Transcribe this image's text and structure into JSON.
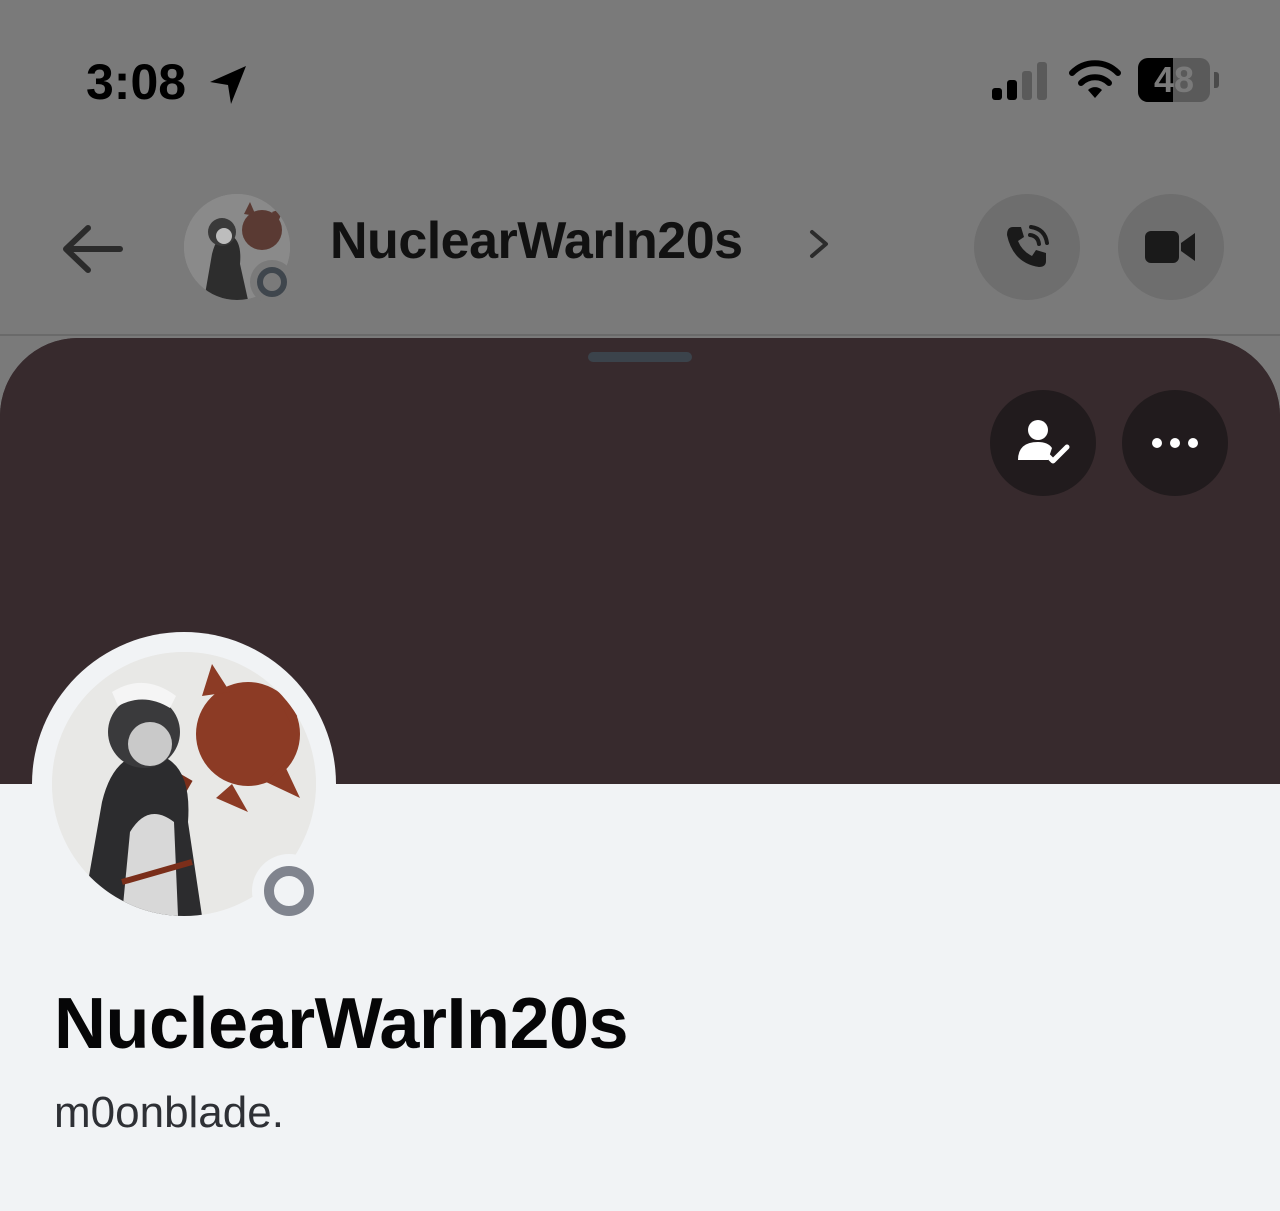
{
  "status_bar": {
    "time": "3:08",
    "battery_level": "48",
    "battery_fraction": 0.48,
    "icons": [
      "location-arrow-icon",
      "cellular-signal-icon",
      "wifi-icon",
      "battery-icon"
    ]
  },
  "header": {
    "title": "NuclearWarIn20s",
    "back_icon": "arrow-left-icon",
    "chevron_icon": "chevron-right-icon",
    "status": "offline",
    "actions": [
      "phone-call-icon",
      "video-camera-icon"
    ]
  },
  "profile": {
    "display_name": "NuclearWarIn20s",
    "username": "m0onblade.",
    "status": "offline",
    "actions": [
      "friend-check-icon",
      "more-options-icon"
    ]
  },
  "colors": {
    "banner": "#372a2d",
    "overlay": "#7a7a7a",
    "body": "#f1f3f5",
    "offline_status": "#80848e"
  }
}
